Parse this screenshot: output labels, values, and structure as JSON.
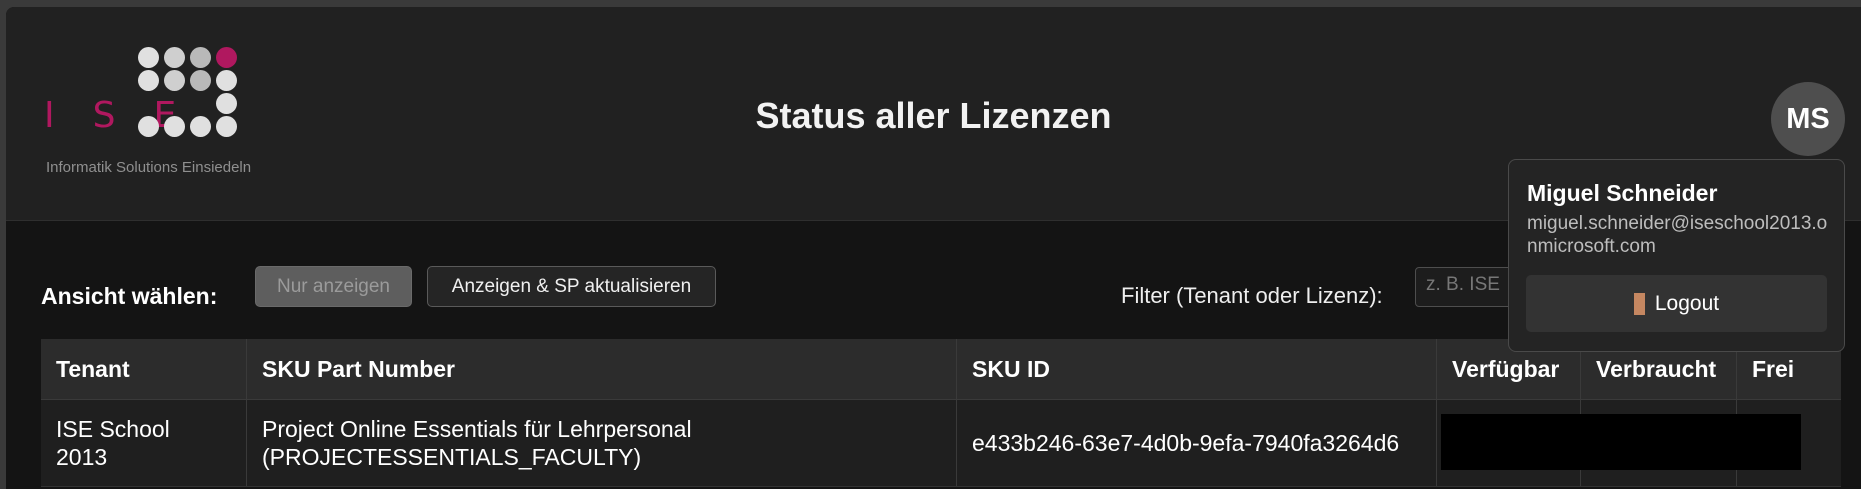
{
  "header": {
    "logo_letters": "ISE",
    "logo_subtitle": "Informatik Solutions Einsiedeln",
    "title": "Status aller Lizenzen",
    "avatar_initials": "MS"
  },
  "toolbar": {
    "label": "Ansicht wählen:",
    "view_only_button": "Nur anzeigen",
    "update_button": "Anzeigen & SP aktualisieren",
    "filter_label": "Filter (Tenant oder Lizenz):",
    "filter_placeholder": "z. B. ISE"
  },
  "table": {
    "columns": [
      "Tenant",
      "SKU Part Number",
      "SKU ID",
      "Verfügbar",
      "Verbraucht",
      "Frei"
    ],
    "rows": [
      {
        "tenant": "ISE School 2013",
        "sku_part_number": "Project Online Essentials für Lehrpersonal (PROJECTESSENTIALS_FACULTY)",
        "sku_id": "e433b246-63e7-4d0b-9efa-7940fa3264d6"
      }
    ]
  },
  "user_menu": {
    "name": "Miguel Schneider",
    "email": "miguel.schneider@iseschool2013.onmicrosoft.com",
    "logout_label": "Logout"
  },
  "colors": {
    "brand_magenta": "#b0185f",
    "background": "#141414",
    "header_bg": "#212121"
  }
}
